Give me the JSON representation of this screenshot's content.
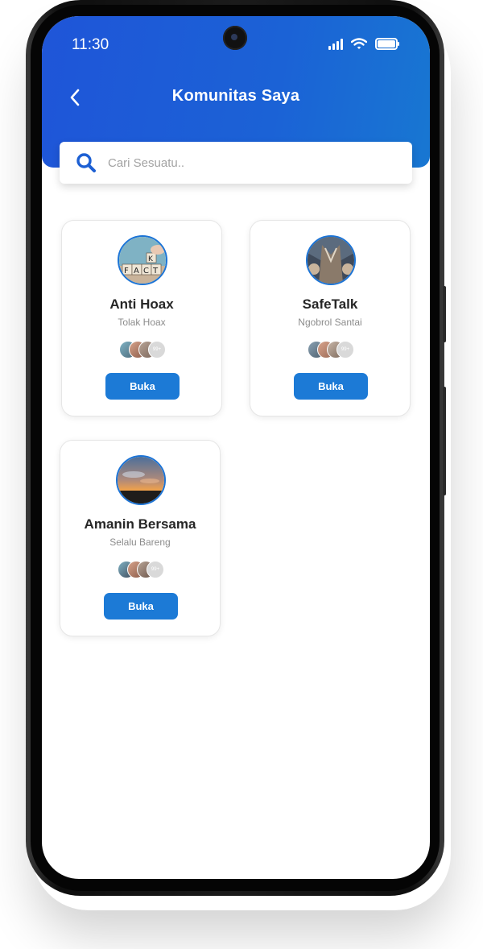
{
  "status": {
    "time": "11:30"
  },
  "header": {
    "title": "Komunitas Saya"
  },
  "search": {
    "placeholder": "Cari Sesuatu.."
  },
  "colors": {
    "primary": "#1c7ad6",
    "header_start": "#1f55d8",
    "header_end": "#1877d2"
  },
  "icons": {
    "back": "chevron-left-icon",
    "search": "search-icon",
    "signal": "signal-icon",
    "wifi": "wifi-icon",
    "battery": "battery-icon"
  },
  "communities": [
    {
      "name": "Anti Hoax",
      "subtitle": "Tolak Hoax",
      "members_more": "99+",
      "button": "Buka"
    },
    {
      "name": "SafeTalk",
      "subtitle": "Ngobrol Santai",
      "members_more": "99+",
      "button": "Buka"
    },
    {
      "name": "Amanin Bersama",
      "subtitle": "Selalu Bareng",
      "members_more": "99+",
      "button": "Buka"
    }
  ]
}
